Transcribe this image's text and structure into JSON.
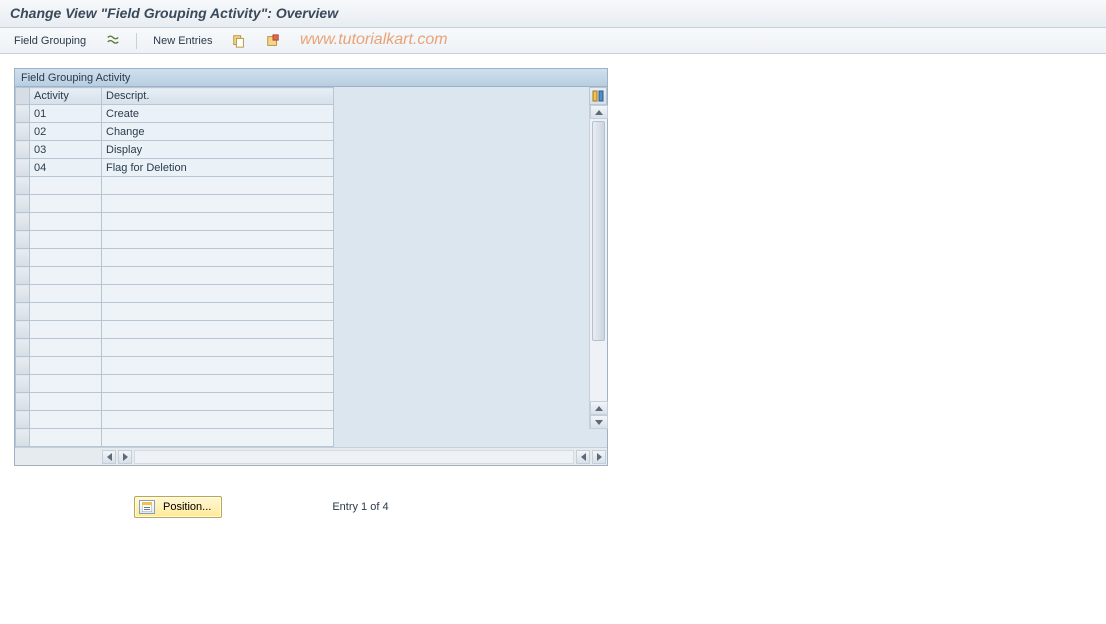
{
  "title": "Change View \"Field Grouping Activity\": Overview",
  "toolbar": {
    "field_grouping": "Field Grouping",
    "new_entries": "New Entries",
    "icons": {
      "details": "details-icon",
      "copy": "copy-icon",
      "delimit": "delimit-icon"
    }
  },
  "watermark": "www.tutorialkart.com",
  "panel": {
    "title": "Field Grouping Activity",
    "columns": {
      "activity": "Activity",
      "description": "Descript."
    },
    "rows": [
      {
        "activity": "01",
        "desc": "Create"
      },
      {
        "activity": "02",
        "desc": "Change"
      },
      {
        "activity": "03",
        "desc": "Display"
      },
      {
        "activity": "04",
        "desc": "Flag for Deletion"
      }
    ],
    "empty_row_count": 15
  },
  "footer": {
    "position_btn": "Position...",
    "entry_text": "Entry 1 of 4"
  }
}
